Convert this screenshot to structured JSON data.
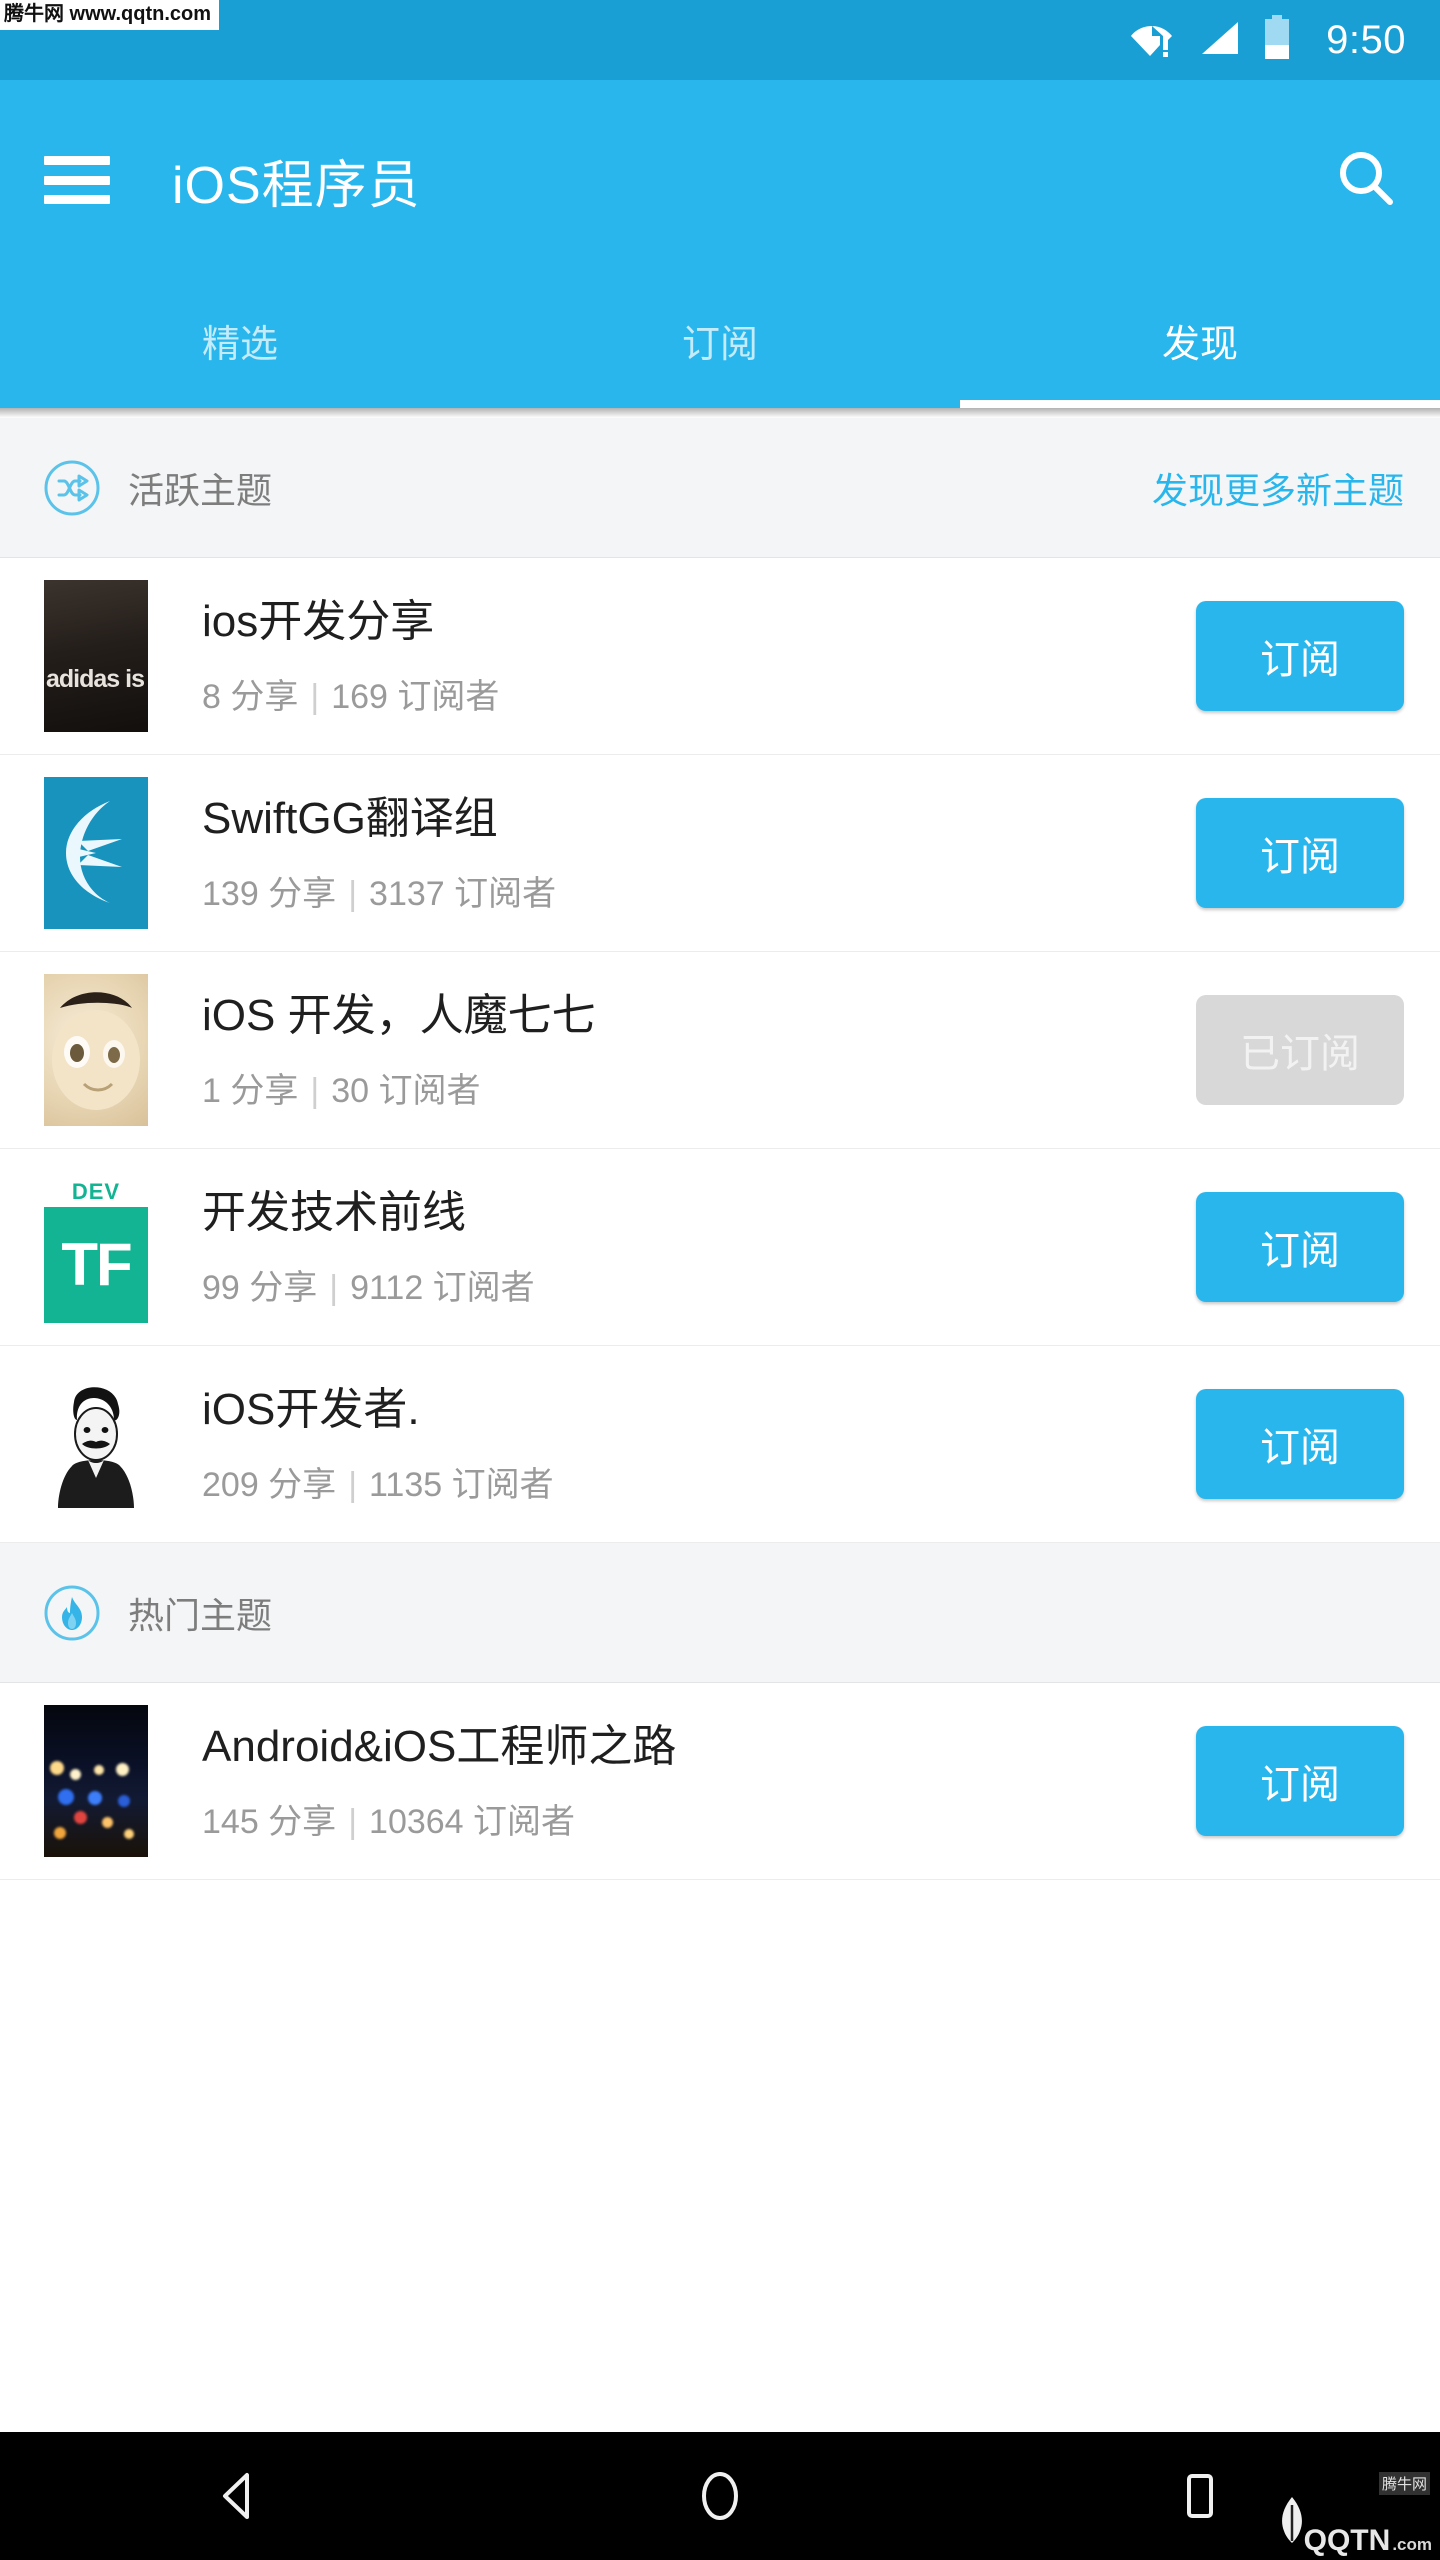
{
  "watermarks": {
    "top": "腾牛网 www.qqtn.com",
    "bottom_brand": "QQTN",
    "bottom_tld": ".com",
    "bottom_cn": "腾牛网"
  },
  "statusbar": {
    "time": "9:50",
    "wifi_icon": "wifi-warning-icon",
    "signal_icon": "cellular-signal-icon",
    "battery_icon": "battery-icon"
  },
  "appbar": {
    "menu_icon": "hamburger-menu-icon",
    "title": "iOS程序员",
    "search_icon": "search-icon",
    "background": "#29b6ec"
  },
  "tabs": {
    "items": [
      {
        "label": "精选",
        "active": false
      },
      {
        "label": "订阅",
        "active": false
      },
      {
        "label": "发现",
        "active": true
      }
    ],
    "indicator_color": "#ffffff"
  },
  "sections": [
    {
      "id": "active-topics",
      "icon": "shuffle-icon",
      "title": "活跃主题",
      "link": "发现更多新主题",
      "link_color": "#29b6ec",
      "items": [
        {
          "name": "ios开发分享",
          "shares": "8 分享",
          "separator": "|",
          "subscribers": "169 订阅者",
          "button": "订阅",
          "subscribed": false,
          "avatar": "adidas-photo-avatar"
        },
        {
          "name": "SwiftGG翻译组",
          "shares": "139 分享",
          "separator": "|",
          "subscribers": "3137 订阅者",
          "button": "订阅",
          "subscribed": false,
          "avatar": "swiftgg-bird-logo-avatar"
        },
        {
          "name": "iOS 开发，人魔七七",
          "shares": "1 分享",
          "separator": "|",
          "subscribers": "30 订阅者",
          "button": "已订阅",
          "subscribed": true,
          "avatar": "anime-portrait-avatar"
        },
        {
          "name": "开发技术前线",
          "shares": "99 分享",
          "separator": "|",
          "subscribers": "9112 订阅者",
          "button": "订阅",
          "subscribed": false,
          "avatar": "dev-tf-logo-avatar"
        },
        {
          "name": "iOS开发者.",
          "shares": "209 分享",
          "separator": "|",
          "subscribers": "1135 订阅者",
          "button": "订阅",
          "subscribed": false,
          "avatar": "mustache-portrait-avatar"
        }
      ]
    },
    {
      "id": "hot-topics",
      "icon": "flame-icon",
      "title": "热门主题",
      "link": "",
      "items": [
        {
          "name": "Android&iOS工程师之路",
          "shares": "145 分享",
          "separator": "|",
          "subscribers": "10364 订阅者",
          "button": "订阅",
          "subscribed": false,
          "avatar": "night-city-photo-avatar"
        }
      ]
    }
  ],
  "navbar": {
    "back_icon": "back-triangle-icon",
    "home_icon": "home-circle-icon",
    "recents_icon": "recents-square-icon"
  },
  "colors": {
    "primary": "#29b6ec",
    "status_bar": "#1a9fd4",
    "section_bg": "#f4f5f6",
    "muted_text": "#9a9a9a",
    "subscribed_bg": "#d8d8d8"
  }
}
